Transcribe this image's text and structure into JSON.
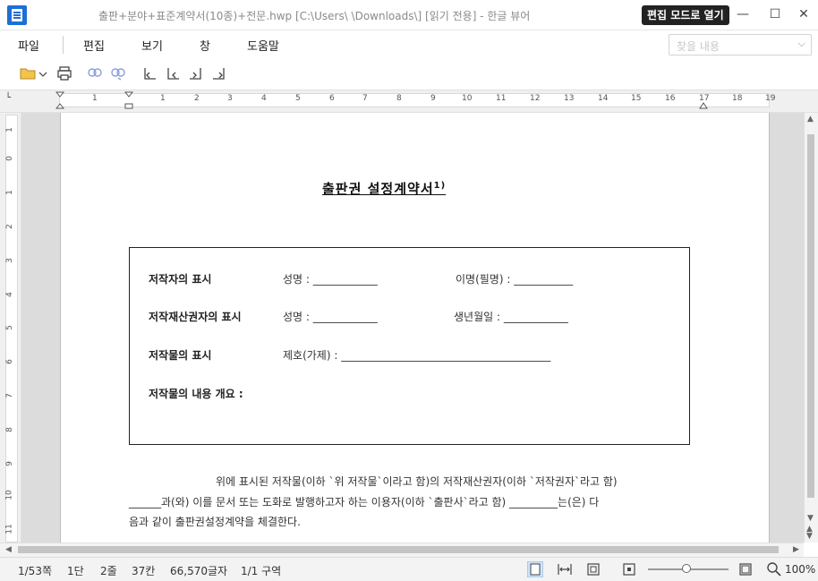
{
  "window": {
    "title": "출판+분야+표준계약서(10종)+전문.hwp [C:\\Users\\         \\Downloads\\] [읽기 전용] - 한글 뷰어",
    "edit_mode_button": "편집 모드로 열기",
    "minimize": "—",
    "maximize": "☐",
    "close": "✕"
  },
  "menu": {
    "items": [
      "파일",
      "편집",
      "보기",
      "창",
      "도움말"
    ],
    "search_placeholder": "찾을 내용"
  },
  "toolbar": {
    "icons": [
      "open-folder-icon",
      "print-icon",
      "find-icon",
      "replace-icon",
      "prev-page-icon",
      "next-page-icon",
      "first-page-icon",
      "last-page-icon"
    ]
  },
  "ruler": {
    "h_numbers": [
      "1",
      "1",
      "2",
      "3",
      "4",
      "5",
      "6",
      "7",
      "8",
      "9",
      "10",
      "11",
      "12",
      "13",
      "14",
      "15",
      "16",
      "17",
      "18",
      "19"
    ],
    "v_numbers": [
      "1",
      "0",
      "1",
      "2",
      "3",
      "4",
      "5",
      "6",
      "7",
      "8",
      "9",
      "10",
      "11"
    ]
  },
  "document": {
    "title": "출판권 설정계약서",
    "footnote": "1)",
    "rows": [
      {
        "label": "저작자의 표시",
        "f1": "성명 : ____________",
        "f2": "이명(필명) : ___________"
      },
      {
        "label": "저작재산권자의 표시",
        "f1": "성명 : ____________",
        "f2": "생년월일  : ____________"
      },
      {
        "label": "저작물의 표시",
        "f1": "제호(가제) : _______________________________________",
        "f2": ""
      },
      {
        "label": "저작물의 내용 개요 :",
        "f1": "",
        "f2": ""
      }
    ],
    "para_line1": "위에 표시된 저작물(이하 `위 저작물`이라고 함)의 저작재산권자(이하 `저작권자`라고 함)",
    "para_line2": "______과(와) 이를 문서 또는 도화로 발행하고자 하는 이용자(이하 `출판사`라고 함)  _________는(은)  다",
    "para_line3": "음과 같이 출판권설정계약을 체결한다."
  },
  "status": {
    "page": "1/53쪽",
    "column": "1단",
    "line": "2줄",
    "cell": "37칸",
    "chars": "66,570글자",
    "section": "1/1 구역",
    "zoom": "100%"
  }
}
